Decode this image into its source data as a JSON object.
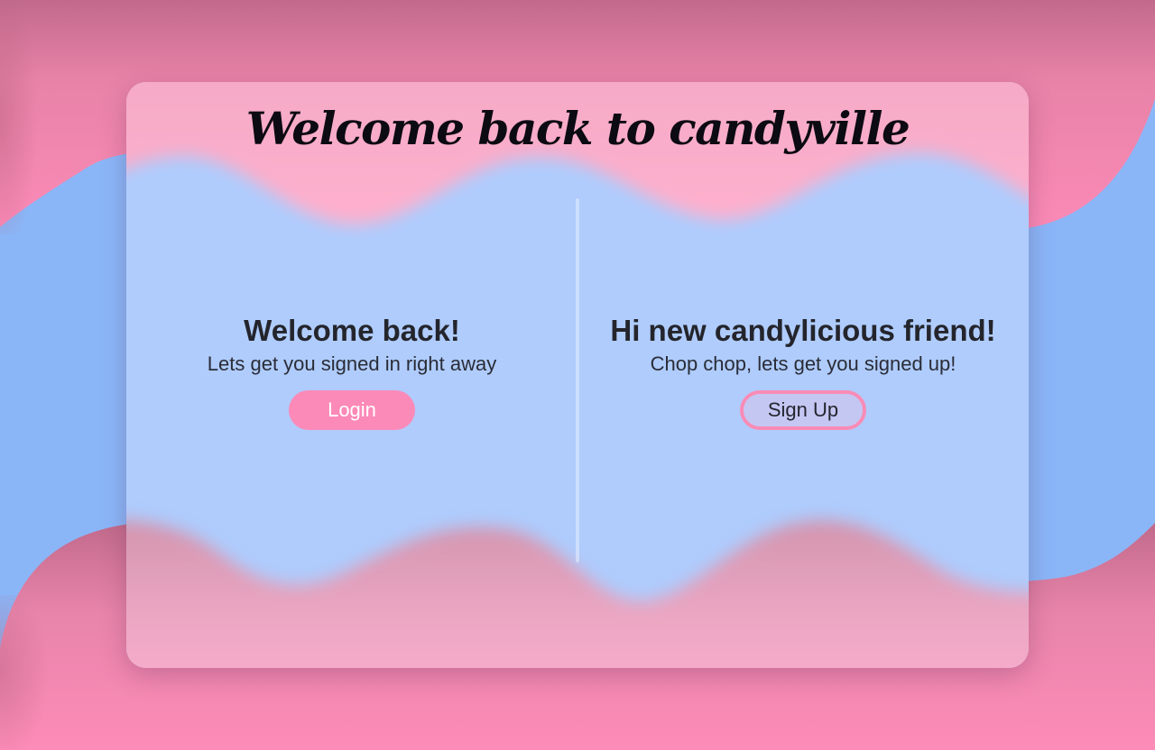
{
  "page": {
    "title": "Welcome back to candyville"
  },
  "login_panel": {
    "heading": "Welcome back!",
    "subtitle": "Lets get you signed in right away",
    "button_label": "Login"
  },
  "signup_panel": {
    "heading": "Hi new candylicious friend!",
    "subtitle": "Chop chop, lets get you signed up!",
    "button_label": "Sign Up"
  },
  "colors": {
    "background_blue": "#8ab6f8",
    "candy_pink": "#fb8ab8",
    "dark_pink": "#c06a8b",
    "card_blue": "#aac9fd",
    "text_dark": "#24252c"
  }
}
